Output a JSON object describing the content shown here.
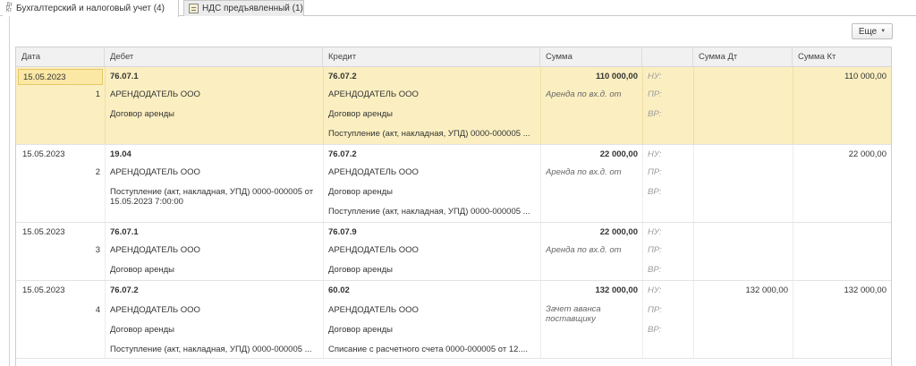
{
  "tabs": [
    {
      "icon": "dt-kt-icon",
      "icon_text": "Дт\nКт",
      "label": "Бухгалтерский и налоговый учет (4)"
    },
    {
      "icon": "table-icon",
      "label": "НДС предъявленный (1)"
    }
  ],
  "toolbar": {
    "more_label": "Еще",
    "more_caret": "▼"
  },
  "columns": {
    "date": "Дата",
    "debit": "Дебет",
    "credit": "Кредит",
    "sum": "Сумма",
    "type": "",
    "sum_dt": "Сумма Дт",
    "sum_kt": "Сумма Кт"
  },
  "rows": [
    {
      "date": "15.05.2023",
      "num": "1",
      "debit_account": "76.07.1",
      "debit_sub": [
        "АРЕНДОДАТЕЛЬ ООО",
        "Договор аренды"
      ],
      "credit_account": "76.07.2",
      "credit_sub": [
        "АРЕНДОДАТЕЛЬ ООО",
        "Договор аренды",
        "Поступление (акт, накладная, УПД) 0000-000005 ..."
      ],
      "sum": "110 000,00",
      "content": "Аренда по вх.д. от",
      "labels": [
        "НУ:",
        "ПР:",
        "ВР:"
      ],
      "sum_dt": "",
      "sum_kt": "110 000,00"
    },
    {
      "date": "15.05.2023",
      "num": "2",
      "debit_account": "19.04",
      "debit_sub": [
        "АРЕНДОДАТЕЛЬ ООО",
        "Поступление (акт, накладная, УПД) 0000-000005 от 15.05.2023 7:00:00"
      ],
      "credit_account": "76.07.2",
      "credit_sub": [
        "АРЕНДОДАТЕЛЬ ООО",
        "Договор аренды",
        "Поступление (акт, накладная, УПД) 0000-000005 ..."
      ],
      "sum": "22 000,00",
      "content": "Аренда по вх.д. от",
      "labels": [
        "НУ:",
        "ПР:",
        "ВР:"
      ],
      "sum_dt": "",
      "sum_kt": "22 000,00"
    },
    {
      "date": "15.05.2023",
      "num": "3",
      "debit_account": "76.07.1",
      "debit_sub": [
        "АРЕНДОДАТЕЛЬ ООО",
        "Договор аренды"
      ],
      "credit_account": "76.07.9",
      "credit_sub": [
        "АРЕНДОДАТЕЛЬ ООО",
        "Договор аренды"
      ],
      "sum": "22 000,00",
      "content": "Аренда по вх.д. от",
      "labels": [
        "НУ:",
        "ПР:",
        "ВР:"
      ],
      "sum_dt": "",
      "sum_kt": ""
    },
    {
      "date": "15.05.2023",
      "num": "4",
      "debit_account": "76.07.2",
      "debit_sub": [
        "АРЕНДОДАТЕЛЬ ООО",
        "Договор аренды",
        "Поступление (акт, накладная, УПД) 0000-000005 ..."
      ],
      "credit_account": "60.02",
      "credit_sub": [
        "АРЕНДОДАТЕЛЬ ООО",
        "Договор аренды",
        "Списание с расчетного счета 0000-000005 от 12...."
      ],
      "sum": "132 000,00",
      "content": "Зачет аванса поставщику",
      "labels": [
        "НУ:",
        "ПР:",
        "ВР:"
      ],
      "sum_dt": "132 000,00",
      "sum_kt": "132 000,00"
    }
  ]
}
